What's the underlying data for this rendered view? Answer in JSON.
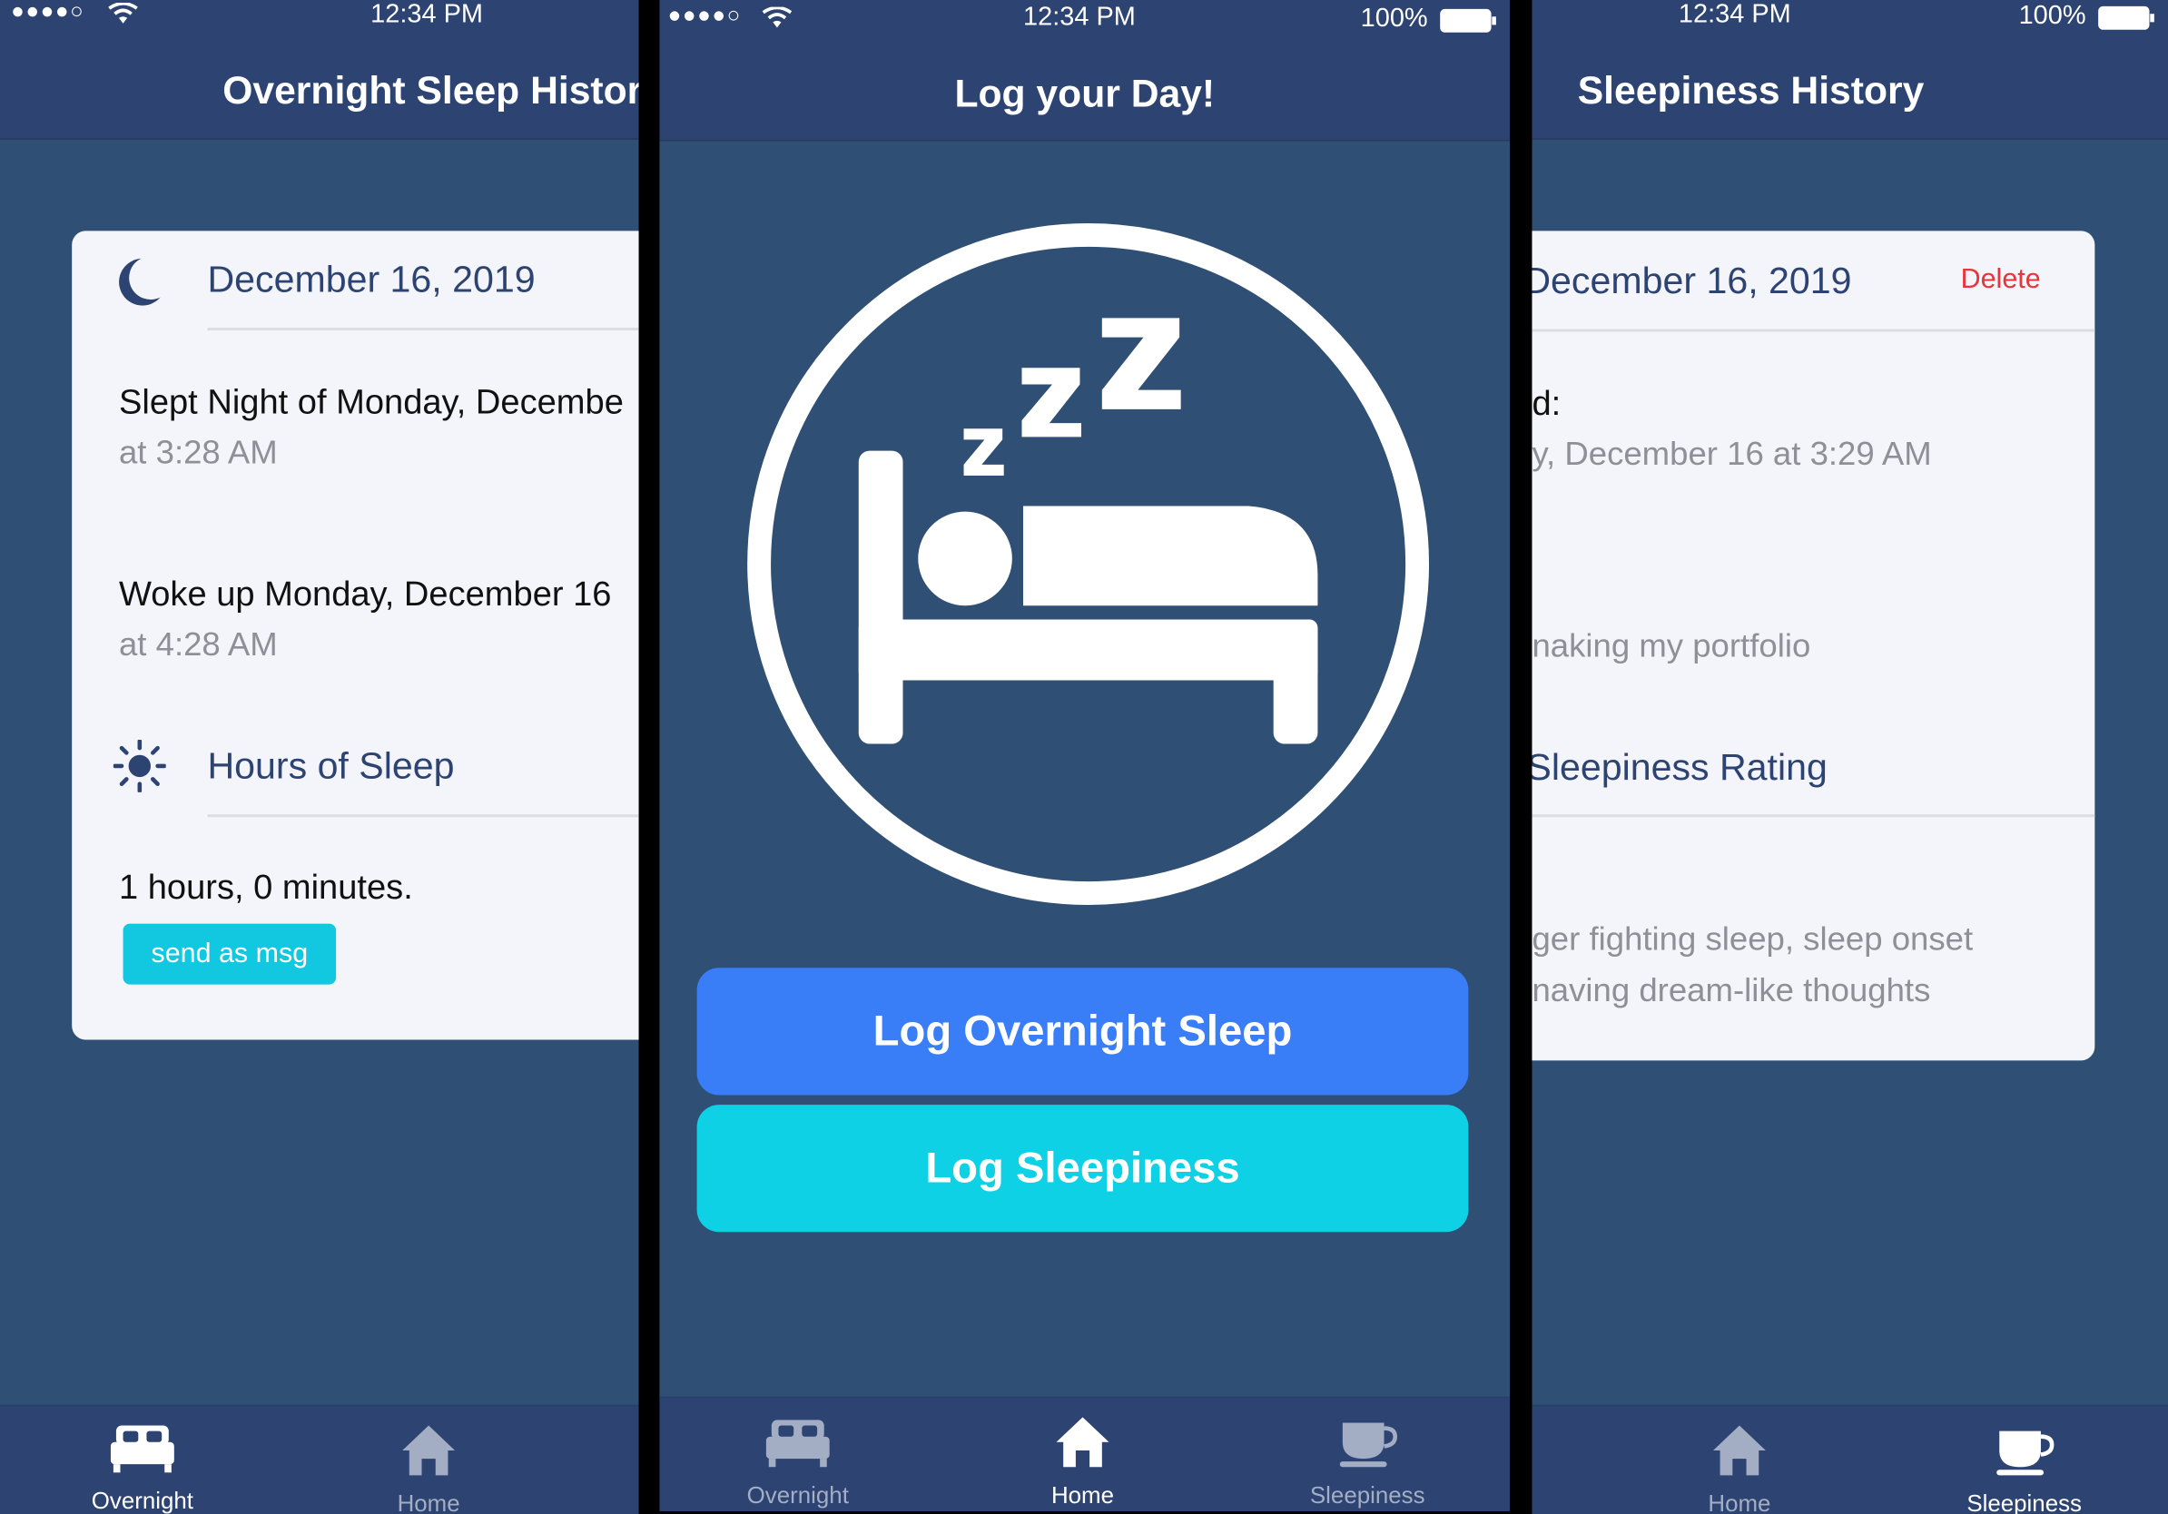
{
  "status": {
    "signal": "●●●●○",
    "time": "12:34 PM",
    "battery": "100%"
  },
  "left": {
    "title": "Overnight Sleep History",
    "card": {
      "date": "December 16, 2019",
      "slept": "Slept Night of Monday, Decembe",
      "slept_time": "at 3:28 AM",
      "woke": "Woke up Monday, December 16",
      "woke_time": "at 4:28 AM",
      "hours_title": "Hours of Sleep",
      "hours_value": "1 hours, 0 minutes.",
      "send_button": "send as msg"
    },
    "tabs": [
      {
        "label": "Overnight",
        "icon": "bed-icon",
        "active": true
      },
      {
        "label": "Home",
        "icon": "home-icon",
        "active": false
      }
    ]
  },
  "center": {
    "title": "Log your Day!",
    "icon": "sleep-bed-zzz-icon",
    "buttons": {
      "log_overnight": "Log Overnight Sleep",
      "log_sleepiness": "Log Sleepiness"
    },
    "tabs": [
      {
        "label": "Overnight",
        "icon": "bed-icon",
        "active": false
      },
      {
        "label": "Home",
        "icon": "home-icon",
        "active": true
      },
      {
        "label": "Sleepiness",
        "icon": "cup-icon",
        "active": false
      }
    ]
  },
  "right": {
    "title": "Sleepiness History",
    "card": {
      "date": "December 16, 2019",
      "date_prefix_hidden": "D",
      "delete": "Delete",
      "logged_label": "d:",
      "logged_time": "y, December 16 at 3:29 AM",
      "note": "naking my portfolio",
      "rating_title": "Sleepiness Rating",
      "rating_line1": "ger fighting sleep, sleep onset",
      "rating_line2": "naving dream-like thoughts"
    },
    "tabs": [
      {
        "label": "Home",
        "icon": "home-icon",
        "active": false
      },
      {
        "label": "Sleepiness",
        "icon": "cup-icon",
        "active": true
      }
    ]
  },
  "colors": {
    "navbar": "#2d4372",
    "background": "#2f4f75",
    "card": "#f4f5fa",
    "primary_button": "#3a7ef7",
    "secondary_button": "#0ed1e6",
    "delete": "#e8343a",
    "accent_text": "#2d4372"
  }
}
